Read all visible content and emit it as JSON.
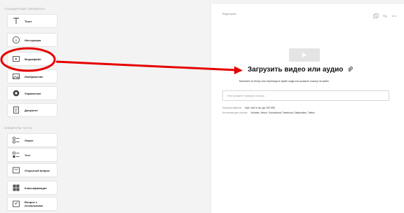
{
  "sidebar": {
    "section_standard": "СТАНДАРТНЫЕ ЭЛЕМЕНТЫ",
    "section_test": "ЭЛЕМЕНТЫ ТЕСТА",
    "standard_items": [
      {
        "label": "Текст",
        "icon": "text-icon"
      },
      {
        "label": "Инструкция",
        "icon": "info-icon"
      },
      {
        "label": "Медиафайл",
        "icon": "media-icon"
      },
      {
        "label": "Изображение",
        "icon": "image-icon"
      },
      {
        "label": "Управление",
        "icon": "control-icon"
      },
      {
        "label": "Документ",
        "icon": "document-icon"
      }
    ],
    "test_items": [
      {
        "label": "Опрос",
        "icon": "survey-icon"
      },
      {
        "label": "Тест",
        "icon": "test-icon"
      },
      {
        "label": "Открытый вопрос",
        "icon": "open-question-icon"
      },
      {
        "label": "Классификация",
        "icon": "classification-icon"
      },
      {
        "label": "Вопрос с несколькими",
        "icon": "multi-question-icon"
      }
    ]
  },
  "main": {
    "breadcrumb": "Видеоурок",
    "top_icons": [
      "duplicate-icon",
      "link-icon",
      "more-icon"
    ],
    "upload_title": "Загрузить видео или аудио",
    "upload_hint": "Кликните по блоку или перетащите файл сюда или укажите ссылку на файл",
    "url_placeholder": "Или укажите прямую ссылку",
    "formats_label": "Загрузка файлов:",
    "formats_value": "mp4, mp3 и пр. (до 100 Мб)",
    "sources_label": "Источники для ссылок:",
    "sources_value": "Youtube, Vimeo, Soundcloud, Facebook, Dailymotion, Twitch"
  },
  "annotation": {
    "color": "#e60000",
    "highlighted_item": "Медиафайл"
  }
}
